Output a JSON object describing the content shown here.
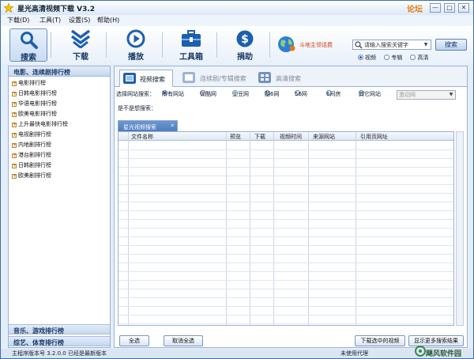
{
  "window": {
    "title": "星光高清视频下载 V3.2",
    "forum_label": "论坛",
    "controls": [
      "—",
      "□",
      "✕"
    ]
  },
  "menu": [
    "下载(D)",
    "工具(T)",
    "设置(S)",
    "帮助(H)"
  ],
  "toolbar": {
    "buttons": [
      {
        "label": "搜索",
        "icon": "search-icon"
      },
      {
        "label": "下载",
        "icon": "download-icon"
      },
      {
        "label": "播放",
        "icon": "play-icon"
      },
      {
        "label": "工具箱",
        "icon": "toolbox-icon"
      },
      {
        "label": "捐助",
        "icon": "donate-icon"
      }
    ],
    "live_text": "斗地主领话费",
    "search_placeholder": "请输入搜索关键字",
    "search_button": "搜索",
    "search_types": [
      {
        "label": "视频",
        "checked": true
      },
      {
        "label": "专辑",
        "checked": false
      },
      {
        "label": "高清",
        "checked": false
      }
    ]
  },
  "sidebar": {
    "section1": "电影、连续剧排行榜",
    "items": [
      "电影排行榜",
      "日韩电影排行榜",
      "华语电影排行榜",
      "欧美电影排行榜",
      "上升最快电影排行榜",
      "电视剧排行榜",
      "内地剧排行榜",
      "港台剧排行榜",
      "日韩剧排行榜",
      "欧美剧排行榜"
    ],
    "section2": "音乐、游戏排行榜",
    "section3": "综艺、体育排行榜"
  },
  "tabs": [
    {
      "label": "视频搜索",
      "active": true
    },
    {
      "label": "连续剧/专辑搜索",
      "active": false
    },
    {
      "label": "高清搜索",
      "active": false
    }
  ],
  "site_select": {
    "label": "选择网站搜索：",
    "options": [
      {
        "label": "所有网站",
        "checked": true
      },
      {
        "label": "优酷网",
        "checked": false
      },
      {
        "label": "土豆网",
        "checked": false
      },
      {
        "label": "酷6网",
        "checked": false
      },
      {
        "label": "56网",
        "checked": false
      },
      {
        "label": "6间房",
        "checked": false
      },
      {
        "label": "其它网站",
        "checked": false
      }
    ],
    "dropdown_value": "激动网"
  },
  "prompt": "是不是想搜索：",
  "results": {
    "tab_label": "星光视频搜索",
    "columns": [
      "文件名称",
      "预览",
      "下载",
      "视频时间",
      "来源网站",
      "引用页网址"
    ],
    "rows": []
  },
  "buttons": {
    "select_all": "全选",
    "cancel_select": "取消全选",
    "download_selected": "下载选中的视频",
    "show_more": "显示更多搜索结果"
  },
  "status": {
    "version": "主程序版本号 3.2.0.0  已经是最新版本",
    "proxy": "未使用代理"
  },
  "watermark": "飓风软件园",
  "colors": {
    "accent": "#1d5fb0",
    "live": "#d04010",
    "forum": "#e07a10"
  }
}
